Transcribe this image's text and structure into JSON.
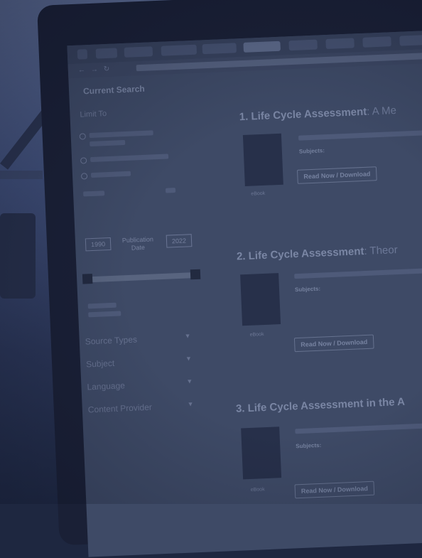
{
  "sidebar": {
    "current_search": "Current Search",
    "limit_to": "Limit To",
    "year_from": "1990",
    "year_label": "Publication Date",
    "year_to": "2022",
    "facets": [
      {
        "label": "Source Types"
      },
      {
        "label": "Subject"
      },
      {
        "label": "Language"
      },
      {
        "label": "Content Provider"
      }
    ]
  },
  "results": [
    {
      "num": "1.",
      "title": "Life Cycle Assessment",
      "subtitle": ": A Me",
      "subjects": "Subjects:",
      "type": "eBook",
      "button": "Read Now / Download"
    },
    {
      "num": "2.",
      "title": "Life Cycle Assessment",
      "subtitle": ": Theor",
      "subjects": "Subjects:",
      "type": "eBook",
      "button": "Read Now / Download"
    },
    {
      "num": "3.",
      "title": "Life Cycle Assessment in the A",
      "subtitle": "",
      "subjects": "Subjects:",
      "type": "eBook",
      "button": "Read Now / Download"
    }
  ],
  "colors": {
    "tint": "#3e4a66",
    "bezel": "#1a2036"
  }
}
